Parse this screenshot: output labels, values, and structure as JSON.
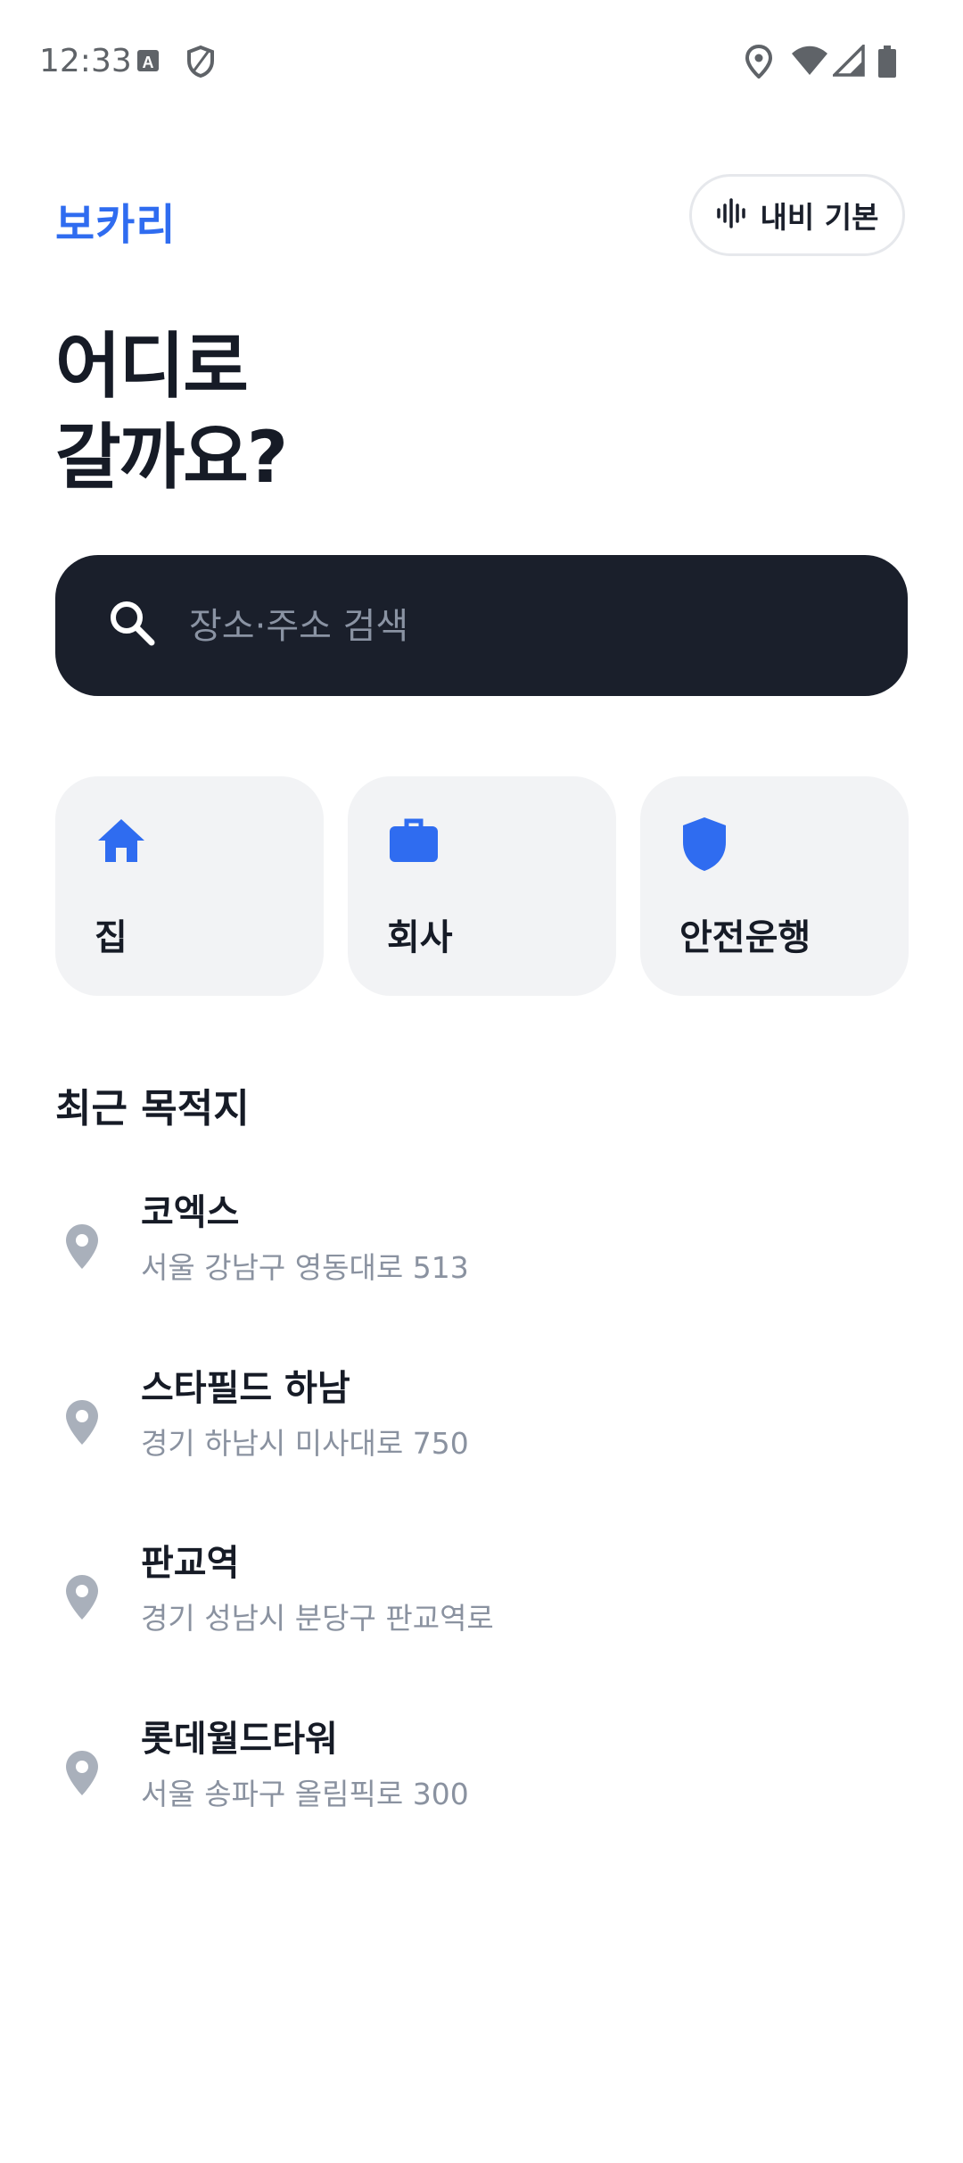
{
  "status_bar": {
    "time": "12:33",
    "left_icons": [
      "text-a-icon",
      "shield-outline-icon"
    ],
    "right_icons": [
      "location-icon",
      "wifi-icon",
      "signal-icon",
      "battery-icon"
    ]
  },
  "header": {
    "brand": "보카리",
    "voice_button_label": "내비 기본",
    "voice_button_icon": "waveform-icon"
  },
  "headline": {
    "line1": "어디로",
    "line2": "갈까요?"
  },
  "search": {
    "placeholder": "장소·주소 검색",
    "value": "",
    "icon": "search-icon"
  },
  "quick_tiles": [
    {
      "label": "집",
      "icon": "home-icon"
    },
    {
      "label": "회사",
      "icon": "briefcase-icon"
    },
    {
      "label": "안전운행",
      "icon": "shield-icon"
    }
  ],
  "recent": {
    "title": "최근 목적지",
    "items": [
      {
        "name": "코엑스",
        "address": "서울 강남구 영동대로 513"
      },
      {
        "name": "스타필드 하남",
        "address": "경기 하남시 미사대로 750"
      },
      {
        "name": "판교역",
        "address": "경기 성남시 분당구 판교역로"
      },
      {
        "name": "롯데월드타워",
        "address": "서울 송파구 올림픽로 300"
      }
    ]
  },
  "colors": {
    "accent": "#2f6cf0",
    "dark": "#1a1f2b",
    "tile_bg": "#f2f3f5",
    "pin": "#a9b0bb"
  }
}
